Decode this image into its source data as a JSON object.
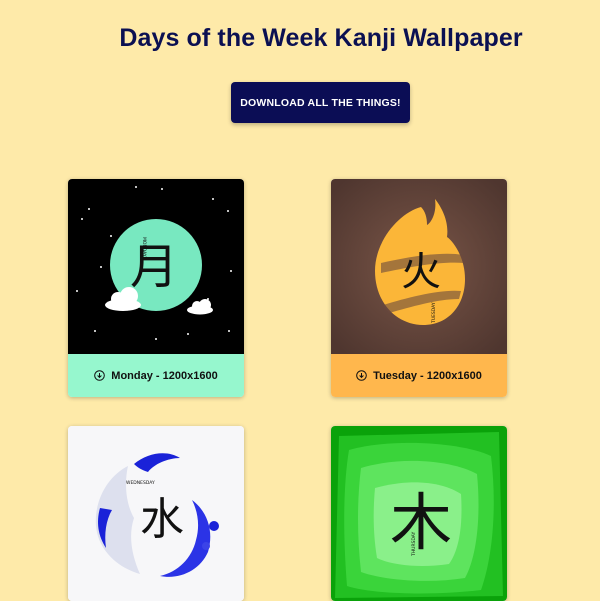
{
  "header": {
    "title": "Days of the Week Kanji Wallpaper",
    "download_all_label": "DOWNLOAD ALL THE THINGS!"
  },
  "colors": {
    "background": "#feeaa9",
    "button": "#0b0d55",
    "monday_bar": "#96f7ce",
    "tuesday_bar": "#ffb74d"
  },
  "cards": [
    {
      "kanji": "月",
      "day_vertical": "MONDAY",
      "download_label": "Monday - 1200x1600",
      "icon": "download-icon"
    },
    {
      "kanji": "火",
      "day_vertical": "TUESDAY",
      "download_label": "Tuesday - 1200x1600",
      "icon": "download-icon"
    },
    {
      "kanji": "水",
      "day_vertical": "WEDNESDAY"
    },
    {
      "kanji": "木",
      "day_vertical": "THURSDAY"
    }
  ]
}
